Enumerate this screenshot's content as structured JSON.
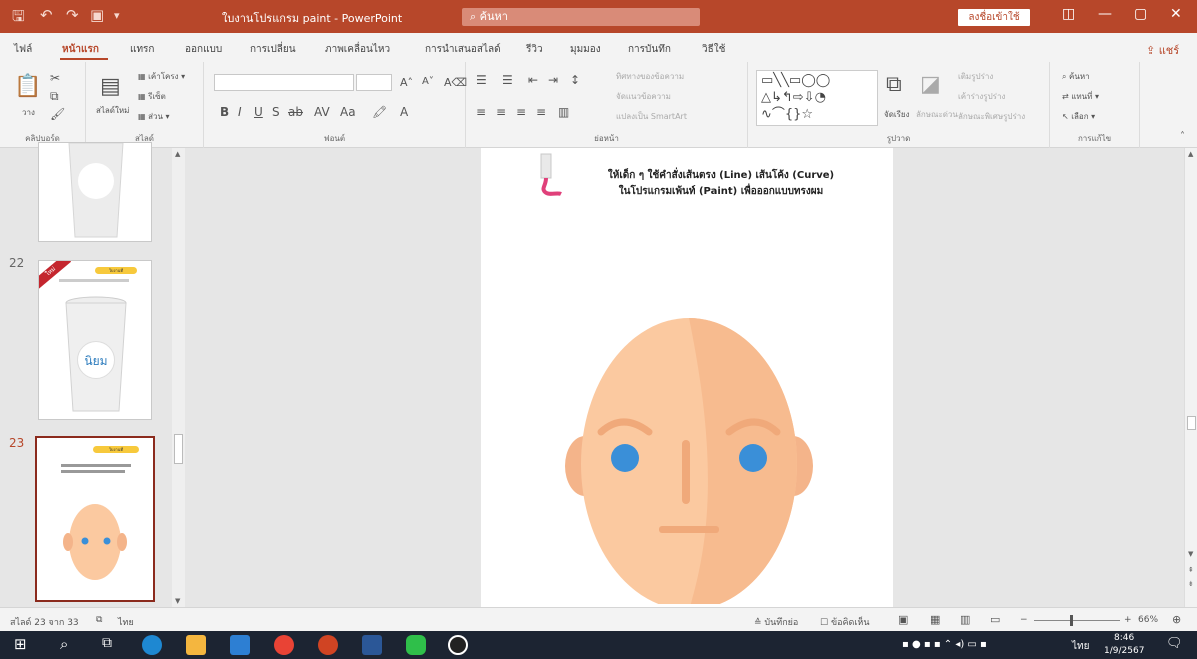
{
  "window": {
    "title": "ใบงานโปรแกรม paint - PowerPoint",
    "search_placeholder": "ค้นหา",
    "signin_label": "ลงชื่อเข้าใช้"
  },
  "tabs": [
    {
      "label": "ไฟล์"
    },
    {
      "label": "หน้าแรก"
    },
    {
      "label": "แทรก"
    },
    {
      "label": "ออกแบบ"
    },
    {
      "label": "การเปลี่ยน"
    },
    {
      "label": "ภาพเคลื่อนไหว"
    },
    {
      "label": "การนำเสนอสไลด์"
    },
    {
      "label": "รีวิว"
    },
    {
      "label": "มุมมอง"
    },
    {
      "label": "การบันทึก"
    },
    {
      "label": "วิธีใช้"
    }
  ],
  "share_label": "แชร์",
  "ribbon": {
    "clipboard": {
      "label": "คลิปบอร์ด",
      "paste": "วาง"
    },
    "slides": {
      "label": "สไลด์",
      "new_slide": "สไลด์ใหม่",
      "layout": "เค้าโครง",
      "reset": "รีเซ็ต",
      "section": "ส่วน"
    },
    "font": {
      "label": "ฟอนต์"
    },
    "paragraph": {
      "label": "ย่อหน้า",
      "text_direction": "ทิศทางของข้อความ",
      "align_text": "จัดแนวข้อความ",
      "smartart": "แปลงเป็น SmartArt"
    },
    "drawing": {
      "label": "รูปวาด",
      "arrange": "จัดเรียง",
      "quick_styles": "ลักษณะด่วน",
      "shape_fill": "เติมรูปร่าง",
      "shape_outline": "เค้าร่างรูปร่าง",
      "shape_effects": "ลักษณะพิเศษรูปร่าง"
    },
    "editing": {
      "label": "การแก้ไข",
      "find": "ค้นหา",
      "replace": "แทนที่",
      "select": "เลือก"
    }
  },
  "thumbnails": [
    {
      "number": "22",
      "badge": "ใหม่",
      "pill": "ใบงานที่",
      "caption_text": "นิยม"
    },
    {
      "number": "23",
      "pill": "ใบงานที่",
      "selected": true
    }
  ],
  "slide": {
    "instruction_line1": "ให้เด็ก ๆ ใช้คำสั่งเส้นตรง (Line) เส้นโค้ง (Curve)",
    "instruction_line2": "ในโปรแกรมเพ้นท์ (Paint) เพื่อออกแบบทรงผม"
  },
  "status": {
    "slide_info": "สไลด์ 23 จาก 33",
    "language": "ไทย",
    "notes": "บันทึกย่อ",
    "comments": "ข้อคิดเห็น",
    "zoom": "66%"
  },
  "taskbar": {
    "time": "8:46",
    "date": "1/9/2567",
    "lang": "ไทย"
  },
  "colors": {
    "accent": "#b7472a",
    "face": "#fbc9a0",
    "face_shade": "#f4b48a",
    "eye": "#3a8fd8",
    "brow": "#f0a97a"
  }
}
